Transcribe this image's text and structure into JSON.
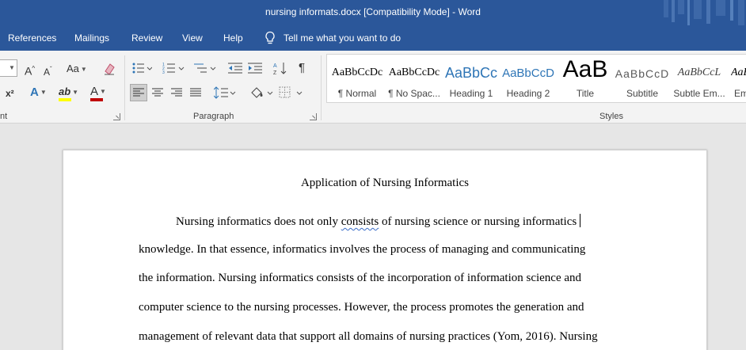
{
  "window": {
    "title": "nursing informats.docx [Compatibility Mode]  -  Word",
    "accent_color": "#2b579a"
  },
  "tabs": [
    {
      "label": "References"
    },
    {
      "label": "Mailings"
    },
    {
      "label": "Review"
    },
    {
      "label": "View"
    },
    {
      "label": "Help"
    }
  ],
  "tell_me": {
    "icon": "lightbulb-icon",
    "label": "Tell me what you want to do"
  },
  "ribbon": {
    "font_group": {
      "label": "nt",
      "grow_font": "A",
      "shrink_font": "A",
      "change_case": "Aa",
      "superscript": "x²",
      "text_effects": "A",
      "highlight_color": "#ffff00",
      "font_color": "#c00000"
    },
    "paragraph_group": {
      "label": "Paragraph"
    },
    "styles_group": {
      "label": "Styles",
      "items": [
        {
          "sample": "AaBbCcDc",
          "name": "¶ Normal"
        },
        {
          "sample": "AaBbCcDc",
          "name": "¶ No Spac..."
        },
        {
          "sample": "AaBbCc",
          "name": "Heading 1"
        },
        {
          "sample": "AaBbCcD",
          "name": "Heading 2"
        },
        {
          "sample": "AaB",
          "name": "Title"
        },
        {
          "sample": "AaBbCcD",
          "name": "Subtitle"
        },
        {
          "sample": "AaBbCcL",
          "name": "Subtle Em..."
        },
        {
          "sample": "AaB",
          "name": "Em"
        }
      ]
    }
  },
  "document": {
    "heading": "Application of Nursing Informatics",
    "lines": [
      {
        "before": "Nursing informatics does not only ",
        "flagged": "consists",
        "after": " of nursing science or nursing informatics"
      },
      {
        "text": "knowledge. In that essence, informatics involves the process of managing and communicating"
      },
      {
        "text": "the information. Nursing informatics consists of the incorporation of information science and"
      },
      {
        "text": "computer science to the nursing processes. However, the process promotes the generation and"
      },
      {
        "text": "management of relevant data that support all domains of nursing practices (Yom, 2016). Nursing"
      }
    ]
  }
}
